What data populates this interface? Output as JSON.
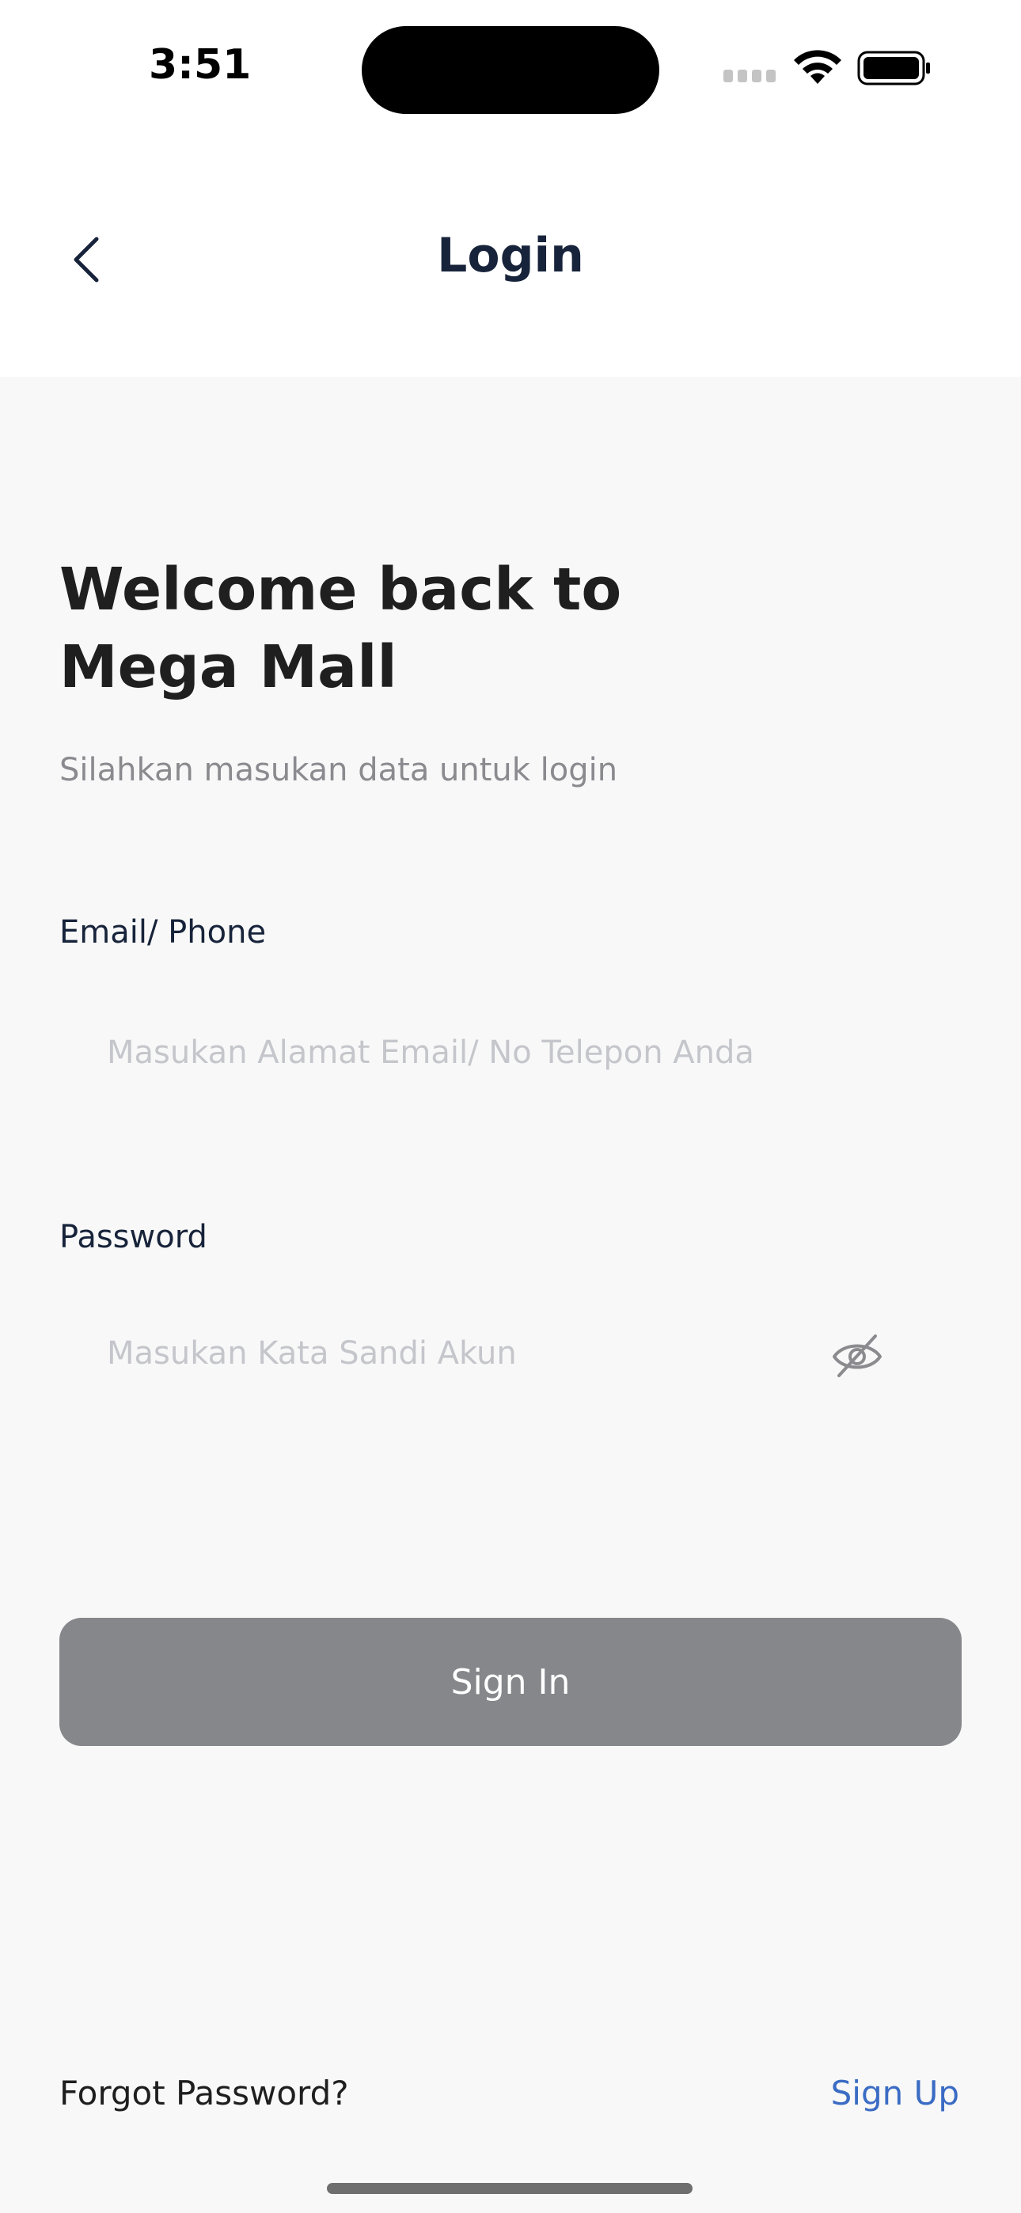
{
  "status_bar": {
    "time": "3:51"
  },
  "header": {
    "title": "Login",
    "back_icon": "chevron-left-icon"
  },
  "welcome": {
    "line1": "Welcome back to",
    "line2": "Mega Mall",
    "subtitle": "Silahkan masukan data untuk login"
  },
  "form": {
    "email_label": "Email/ Phone",
    "email_placeholder": "Masukan Alamat Email/ No Telepon Anda",
    "email_value": "",
    "password_label": "Password",
    "password_placeholder": "Masukan Kata Sandi Akun",
    "password_value": "",
    "password_toggle_icon": "eye-off-icon",
    "signin_label": "Sign In"
  },
  "footer": {
    "forgot_label": "Forgot Password?",
    "signup_label": "Sign Up"
  },
  "colors": {
    "signin_bg": "#86878b",
    "link": "#3b6cc4",
    "title": "#17233a",
    "content_bg": "#f8f8f8"
  }
}
